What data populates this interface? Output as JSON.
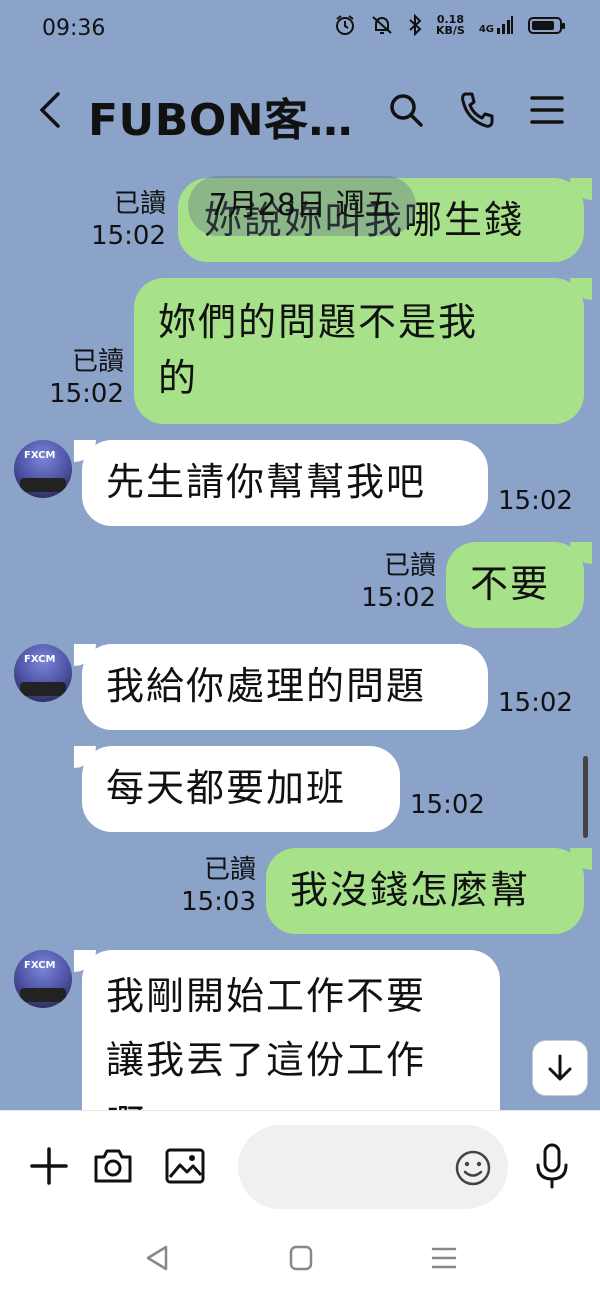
{
  "status_bar": {
    "time": "09:36",
    "net_speed_value": "0.18",
    "net_speed_unit": "KB/S",
    "signal": "4G",
    "battery_level": 0.85
  },
  "header": {
    "title": "FUBON客…",
    "icons": [
      "back-icon",
      "search-icon",
      "phone-icon",
      "menu-icon"
    ]
  },
  "chat": {
    "date_chip": "7月28日 週五",
    "messages": [
      {
        "side": "me",
        "text": "妳說妳叫我哪生錢",
        "read": "已讀",
        "time": "15:02"
      },
      {
        "side": "me",
        "text_line1": "妳們的問題不是我",
        "text_line2": "的",
        "read": "已讀",
        "time": "15:02"
      },
      {
        "side": "them",
        "text": "先生請你幫幫我吧",
        "time": "15:02"
      },
      {
        "side": "me",
        "text": "不要",
        "read": "已讀",
        "time": "15:02"
      },
      {
        "side": "them",
        "text": "我給你處理的問題",
        "time": "15:02"
      },
      {
        "side": "them",
        "text": "每天都要加班",
        "time": "15:02"
      },
      {
        "side": "me",
        "text": "我沒錢怎麼幫",
        "read": "已讀",
        "time": "15:03"
      },
      {
        "side": "them",
        "text_line1": "我剛開始工作不要",
        "text_line2": "讓我丟了這份工作",
        "text_line3": "啊"
      }
    ],
    "avatar_logo": "FXCM"
  },
  "composer": {
    "placeholder": "",
    "icons": [
      "plus-icon",
      "camera-icon",
      "image-icon",
      "emoji-icon",
      "microphone-icon"
    ]
  },
  "colors": {
    "background": "#8ca3c9",
    "my_bubble": "#a7e28a",
    "their_bubble": "#ffffff"
  }
}
